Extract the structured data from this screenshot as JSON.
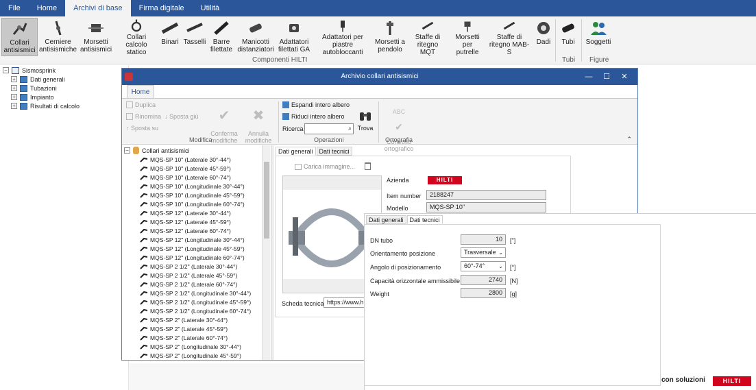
{
  "menubar": {
    "items": [
      "File",
      "Home",
      "Archivi di base",
      "Firma digitale",
      "Utilità"
    ]
  },
  "ribbon": {
    "buttons": [
      "Collari\nantisismici",
      "Cerniere\nantisismiche",
      "Morsetti\nantisismici",
      "Collari calcolo\nstatico",
      "Binari",
      "Tasselli",
      "Barre\nfilettate",
      "Manicotti\ndistanziatori",
      "Adattatori\nfilettati GA",
      "Adattatori per piastre\nautobloccanti",
      "Morsetti a\npendolo",
      "Staffe di\nritegno MQT",
      "Morsetti\nper putrelle",
      "Staffe di\nritegno MAB-S",
      "Dadi",
      "Tubi",
      "Soggetti"
    ],
    "groups": {
      "componenti": "Componenti HILTI",
      "tubi": "Tubi",
      "figure": "Figure"
    }
  },
  "tree": {
    "root": "Sismosprink",
    "items": [
      "Dati generali",
      "Tubazioni",
      "Impianto",
      "Risultati di calcolo"
    ]
  },
  "window": {
    "title": "Archivio collari antisismici",
    "tab": "Home",
    "ops": {
      "duplica": "Duplica",
      "rinomina": "Rinomina",
      "sposta_giu": "Sposta giù",
      "sposta_su": "Sposta su",
      "conferma": "Conferma\nmodifiche",
      "annulla": "Annulla\nmodifiche",
      "modifica_group": "Modifica",
      "espandi": "Espandi intero albero",
      "riduci": "Riduci intero albero",
      "ricerca": "Ricerca",
      "trova": "Trova",
      "operazioni_group": "Operazioni",
      "controllo": "Controllo\nortografico",
      "abc": "ABC",
      "ortografia_group": "Ortografia"
    },
    "list": {
      "root": "Collari antisismici",
      "items": [
        "MQS-SP 10\" (Laterale 30°-44°)",
        "MQS-SP 10\" (Laterale 45°-59°)",
        "MQS-SP 10\" (Laterale 60°-74°)",
        "MQS-SP 10\" (Longitudinale 30°-44°)",
        "MQS-SP 10\" (Longitudinale 45°-59°)",
        "MQS-SP 10\" (Longitudinale 60°-74°)",
        "MQS-SP 12\" (Laterale 30°-44°)",
        "MQS-SP 12\" (Laterale 45°-59°)",
        "MQS-SP 12\" (Laterale 60°-74°)",
        "MQS-SP 12\" (Longitudinale 30°-44°)",
        "MQS-SP 12\" (Longitudinale 45°-59°)",
        "MQS-SP 12\" (Longitudinale 60°-74°)",
        "MQS-SP 2 1/2\" (Laterale 30°-44°)",
        "MQS-SP 2 1/2\" (Laterale 45°-59°)",
        "MQS-SP 2 1/2\" (Laterale 60°-74°)",
        "MQS-SP 2 1/2\" (Longitudinale 30°-44°)",
        "MQS-SP 2 1/2\" (Longitudinale 45°-59°)",
        "MQS-SP 2 1/2\" (Longitudinale 60°-74°)",
        "MQS-SP 2\" (Laterale 30°-44°)",
        "MQS-SP 2\" (Laterale 45°-59°)",
        "MQS-SP 2\" (Laterale 60°-74°)",
        "MQS-SP 2\" (Longitudinale 30°-44°)",
        "MQS-SP 2\" (Longitudinale 45°-59°)"
      ]
    },
    "details": {
      "tabs": [
        "Dati generali",
        "Dati tecnici"
      ],
      "carica": "Carica immagine...",
      "azienda_label": "Azienda",
      "azienda_logo": "HILTI",
      "item_label": "Item number",
      "item_value": "2188247",
      "modello_label": "Modello",
      "modello_value": "MQS-SP 10\"",
      "scheda_label": "Scheda tecnica",
      "scheda_value": "https://www.hilti"
    }
  },
  "tech": {
    "tabs": [
      "Dati generali",
      "Dati tecnici"
    ],
    "fields": [
      {
        "label": "DN tubo",
        "value": "10",
        "unit": "[\"]"
      },
      {
        "label": "Orientamento posizione",
        "value": "Trasversale",
        "unit": ""
      },
      {
        "label": "Angolo di posizionamento",
        "value": "60°-74°",
        "unit": "[°]"
      },
      {
        "label": "Capacità orizzontale ammissibile F",
        "value": "2740",
        "unit": "[N]"
      },
      {
        "label": "Weight",
        "value": "2800",
        "unit": "[g]"
      }
    ]
  },
  "footer": {
    "text": "con soluzioni",
    "logo": "HILTI"
  },
  "colors": {
    "accent": "#2b579a",
    "hilti_red": "#d2051e"
  }
}
